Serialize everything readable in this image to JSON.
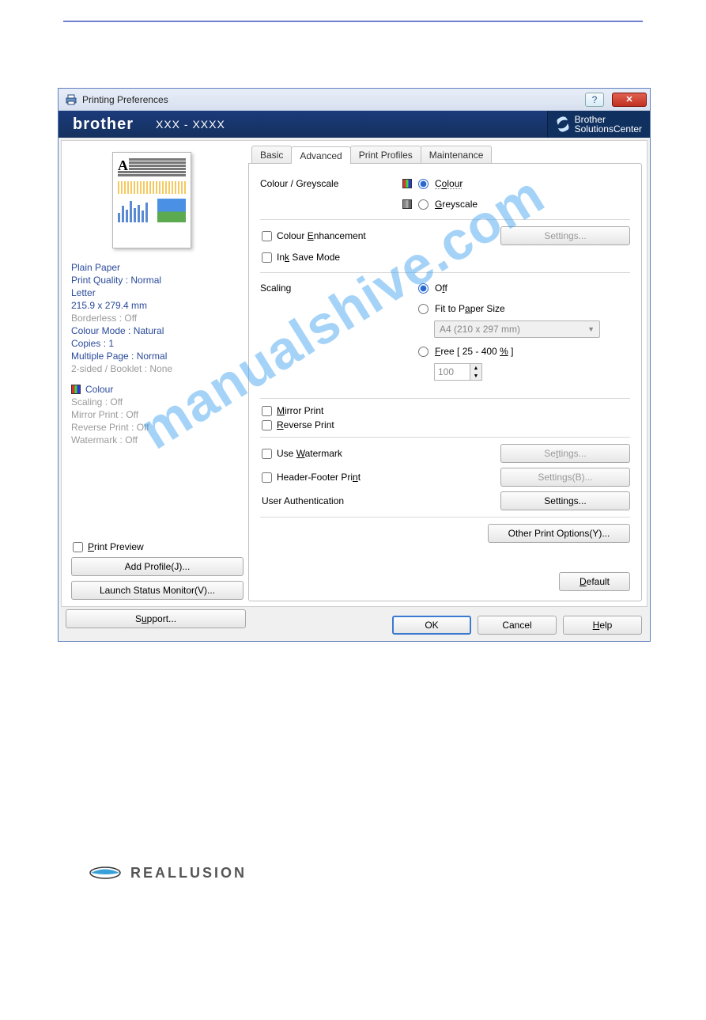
{
  "watermark": "manualshive.com",
  "dialog": {
    "title": "Printing Preferences",
    "brand": "brother",
    "model": "XXX - XXXX",
    "solutions_center_line1": "Brother",
    "solutions_center_line2": "SolutionsCenter",
    "tabs": {
      "basic": "Basic",
      "advanced": "Advanced",
      "profiles": "Print Profiles",
      "maintenance": "Maintenance"
    },
    "summary": {
      "paper": "Plain Paper",
      "quality": "Print Quality : Normal",
      "papersize_name": "Letter",
      "papersize_dim": "215.9 x 279.4 mm",
      "borderless": "Borderless : Off",
      "colourmode": "Colour Mode : Natural",
      "copies": "Copies : 1",
      "multipage": "Multiple Page : Normal",
      "duplex": "2-sided / Booklet : None",
      "colour": "Colour",
      "scaling": "Scaling : Off",
      "mirror": "Mirror Print : Off",
      "reverse": "Reverse Print : Off",
      "watermark": "Watermark : Off"
    },
    "left_bottom": {
      "preview": "Print Preview",
      "add_profile": "Add Profile(J)...",
      "status_monitor": "Launch Status Monitor(V)...",
      "support": "Support..."
    },
    "adv": {
      "colour_greyscale_label": "Colour / Greyscale",
      "colour_option": "Colour",
      "greyscale_option": "Greyscale",
      "colour_enhancement": "Colour Enhancement",
      "settings_btn": "Settings...",
      "ink_save": "Ink Save Mode",
      "scaling_label": "Scaling",
      "scaling_off": "Off",
      "fit": "Fit to Paper Size",
      "fit_value": "A4 (210 x 297 mm)",
      "free_label": "Free [ 25 - 400 % ]",
      "free_value": "100",
      "mirror": "Mirror Print",
      "reverse": "Reverse Print",
      "use_watermark": "Use Watermark",
      "wm_settings": "Settings...",
      "header_footer": "Header-Footer Print",
      "hf_settings": "Settings(B)...",
      "user_auth": "User Authentication",
      "ua_settings": "Settings...",
      "other_options": "Other Print Options(Y)...",
      "default": "Default"
    },
    "buttons": {
      "ok": "OK",
      "cancel": "Cancel",
      "help": "Help"
    }
  },
  "footer": {
    "reallusion": "REALLUSION"
  }
}
